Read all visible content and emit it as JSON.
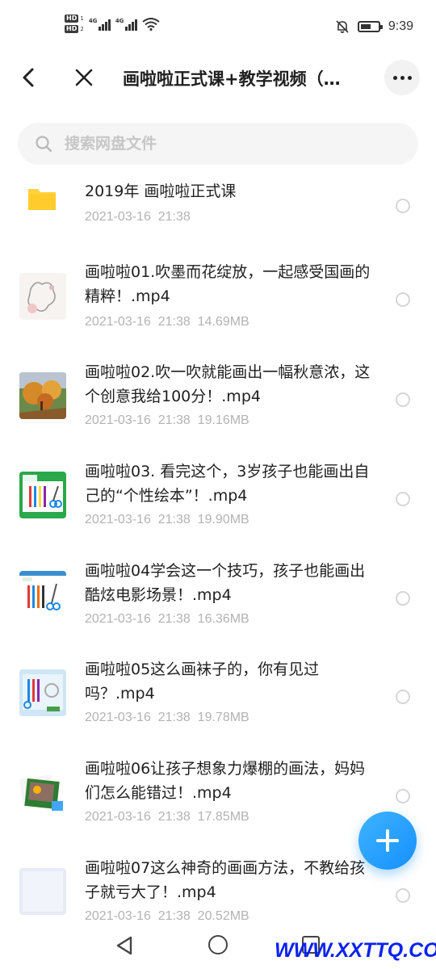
{
  "status_bar": {
    "hd1_num": "1",
    "hd2_num": "2",
    "network1": "4G",
    "network2": "4G",
    "time": "9:39",
    "battery_level": 0.6,
    "icons": [
      "hd-icon",
      "signal-icon",
      "wifi-icon",
      "mute-bell-icon",
      "battery-icon"
    ]
  },
  "header": {
    "title": "画啦啦正式课+教学视频（…",
    "back_icon": "chevron-left-icon",
    "close_icon": "close-icon",
    "more_icon": "more-horizontal-icon"
  },
  "search": {
    "placeholder": "搜索网盘文件",
    "value": ""
  },
  "files": [
    {
      "type": "folder",
      "name": "2019年  画啦啦正式课",
      "date": "2021-03-16  21:38",
      "size": ""
    },
    {
      "type": "video",
      "name": "画啦啦01.吹墨而花绽放，一起感受国画的精粹！.mp4",
      "date": "2021-03-16  21:38",
      "size": "14.69MB"
    },
    {
      "type": "video",
      "name": "画啦啦02.吹一吹就能画出一幅秋意浓，这个创意我给100分！.mp4",
      "date": "2021-03-16  21:38",
      "size": "19.16MB"
    },
    {
      "type": "video",
      "name": "画啦啦03. 看完这个，3岁孩子也能画出自己的“个性绘本”！.mp4",
      "date": "2021-03-16  21:38",
      "size": "19.90MB"
    },
    {
      "type": "video",
      "name": "画啦啦04学会这一个技巧，孩子也能画出酷炫电影场景！.mp4",
      "date": "2021-03-16  21:38",
      "size": "16.36MB"
    },
    {
      "type": "video",
      "name": "画啦啦05这么画袜子的，你有见过吗？.mp4",
      "date": "2021-03-16  21:38",
      "size": "19.78MB"
    },
    {
      "type": "video",
      "name": "画啦啦06让孩子想象力爆棚的画法，妈妈们怎么能错过！.mp4",
      "date": "2021-03-16  21:38",
      "size": "17.85MB"
    },
    {
      "type": "video",
      "name": "画啦啦07这么神奇的画画方法，不教给孩子就亏大了！.mp4",
      "date": "2021-03-16  21:38",
      "size": "20.52MB"
    }
  ],
  "fab": {
    "icon": "plus-icon"
  },
  "nav": {
    "icons": [
      "nav-back-icon",
      "nav-home-icon",
      "nav-recent-icon"
    ]
  },
  "watermark": "WWW.XXTTQ.COM",
  "colors": {
    "accent": "#1590ff",
    "folder": "#ffd23f",
    "meta_text": "#b3b3b3"
  }
}
